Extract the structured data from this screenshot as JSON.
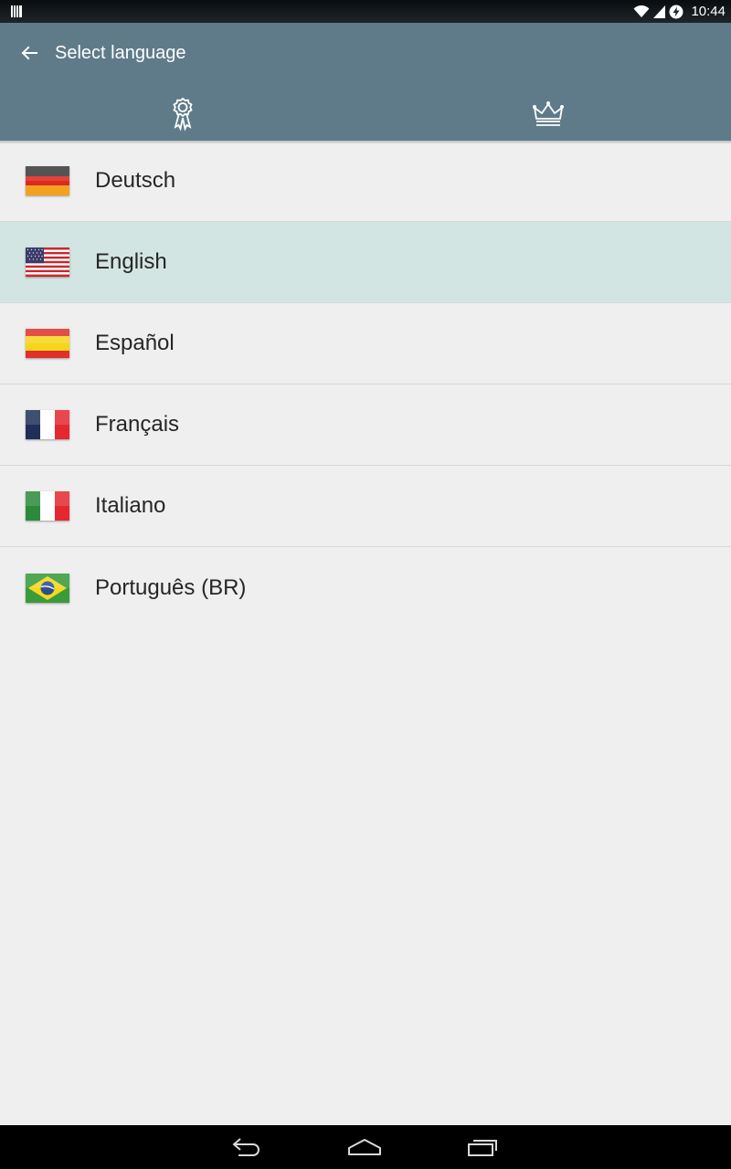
{
  "status_bar": {
    "time": "10:44",
    "icons": [
      "barcode-icon",
      "wifi-icon",
      "signal-icon",
      "battery-charging-icon"
    ]
  },
  "header": {
    "title": "Select language",
    "back_icon": "arrow-left-icon",
    "tabs": [
      {
        "icon": "award-ribbon-icon"
      },
      {
        "icon": "crown-icon"
      }
    ],
    "color": "#5f7b89"
  },
  "languages": [
    {
      "label": "Deutsch",
      "flag": "germany-flag-icon",
      "selected": false
    },
    {
      "label": "English",
      "flag": "usa-flag-icon",
      "selected": true
    },
    {
      "label": "Español",
      "flag": "spain-flag-icon",
      "selected": false
    },
    {
      "label": "Français",
      "flag": "france-flag-icon",
      "selected": false
    },
    {
      "label": "Italiano",
      "flag": "italy-flag-icon",
      "selected": false
    },
    {
      "label": "Português (BR)",
      "flag": "brazil-flag-icon",
      "selected": false
    }
  ],
  "selected_color": "#d3e5e2",
  "nav_bar": {
    "icons": [
      "nav-back-icon",
      "nav-home-icon",
      "nav-recent-apps-icon"
    ]
  }
}
